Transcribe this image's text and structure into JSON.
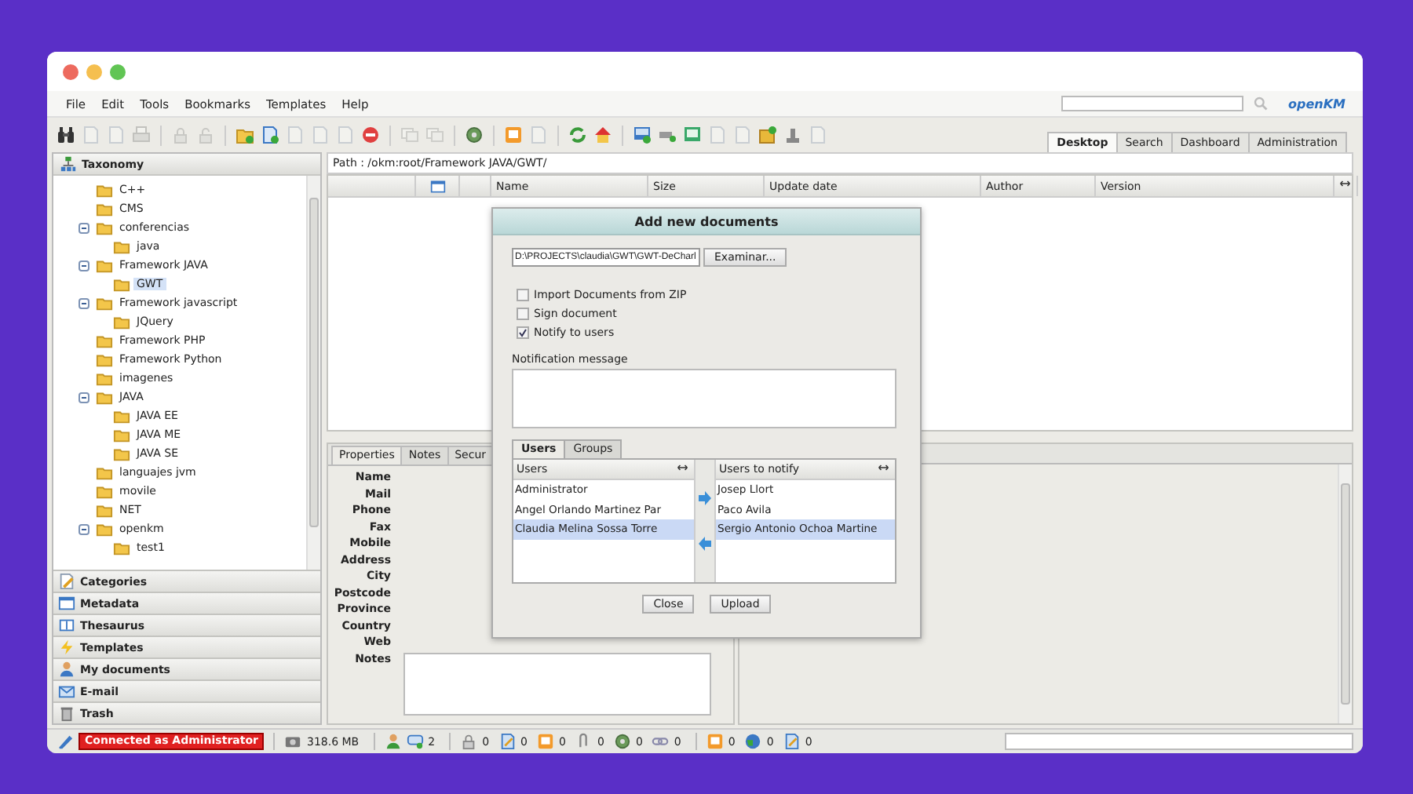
{
  "menu": [
    "File",
    "Edit",
    "Tools",
    "Bookmarks",
    "Templates",
    "Help"
  ],
  "logo": "openKM",
  "toolbar": [
    {
      "kind": "binoculars",
      "disabled": false
    },
    {
      "kind": "document",
      "disabled": true
    },
    {
      "kind": "document",
      "disabled": true
    },
    {
      "kind": "printer",
      "disabled": true
    },
    {
      "kind": "separator"
    },
    {
      "kind": "padlock",
      "disabled": true
    },
    {
      "kind": "padlock-open",
      "disabled": true
    },
    {
      "kind": "separator"
    },
    {
      "kind": "folder-plus",
      "disabled": false
    },
    {
      "kind": "document-plus",
      "disabled": false
    },
    {
      "kind": "document",
      "disabled": true
    },
    {
      "kind": "document",
      "disabled": true
    },
    {
      "kind": "document",
      "disabled": true
    },
    {
      "kind": "delete",
      "disabled": false
    },
    {
      "kind": "separator"
    },
    {
      "kind": "copy",
      "disabled": true
    },
    {
      "kind": "copy",
      "disabled": true
    },
    {
      "kind": "separator"
    },
    {
      "kind": "gear",
      "disabled": false
    },
    {
      "kind": "separator"
    },
    {
      "kind": "note",
      "disabled": false
    },
    {
      "kind": "document",
      "disabled": true
    },
    {
      "kind": "separator"
    },
    {
      "kind": "refresh",
      "disabled": false
    },
    {
      "kind": "home",
      "disabled": false
    },
    {
      "kind": "separator"
    },
    {
      "kind": "monitor-plus",
      "disabled": false
    },
    {
      "kind": "pipe",
      "disabled": false
    },
    {
      "kind": "monitor",
      "disabled": false
    },
    {
      "kind": "document",
      "disabled": true
    },
    {
      "kind": "document",
      "disabled": true
    },
    {
      "kind": "package",
      "disabled": false
    },
    {
      "kind": "stamp",
      "disabled": false
    },
    {
      "kind": "document",
      "disabled": true
    }
  ],
  "main_tabs": [
    {
      "label": "Desktop",
      "selected": true
    },
    {
      "label": "Search",
      "selected": false
    },
    {
      "label": "Dashboard",
      "selected": false
    },
    {
      "label": "Administration",
      "selected": false
    }
  ],
  "taxonomy": {
    "title": "Taxonomy",
    "tree": [
      {
        "label": "C++",
        "selected": false
      },
      {
        "label": "CMS",
        "selected": false
      },
      {
        "label": "conferencias",
        "selected": false,
        "expanded": true,
        "children": [
          {
            "label": "java",
            "selected": false
          }
        ]
      },
      {
        "label": "Framework JAVA",
        "selected": false,
        "expanded": true,
        "children": [
          {
            "label": "GWT",
            "selected": true
          }
        ]
      },
      {
        "label": "Framework javascript",
        "selected": false,
        "expanded": true,
        "children": [
          {
            "label": "JQuery",
            "selected": false
          }
        ]
      },
      {
        "label": "Framework PHP",
        "selected": false
      },
      {
        "label": "Framework Python",
        "selected": false
      },
      {
        "label": "imagenes",
        "selected": false
      },
      {
        "label": "JAVA",
        "selected": false,
        "expanded": true,
        "children": [
          {
            "label": "JAVA EE",
            "selected": false
          },
          {
            "label": "JAVA ME",
            "selected": false
          },
          {
            "label": "JAVA SE",
            "selected": false
          }
        ]
      },
      {
        "label": "languajes jvm",
        "selected": false
      },
      {
        "label": "movile",
        "selected": false
      },
      {
        "label": "NET",
        "selected": false
      },
      {
        "label": "openkm",
        "selected": false,
        "expanded": true,
        "children": [
          {
            "label": "test1",
            "selected": false
          }
        ]
      }
    ]
  },
  "panels": [
    {
      "label": "Categories",
      "kind": "pencil"
    },
    {
      "label": "Metadata",
      "kind": "table"
    },
    {
      "label": "Thesaurus",
      "kind": "book"
    },
    {
      "label": "Templates",
      "kind": "bolt"
    },
    {
      "label": "My documents",
      "kind": "person"
    },
    {
      "label": "E-mail",
      "kind": "envelope"
    },
    {
      "label": "Trash",
      "kind": "trash"
    }
  ],
  "path": "Path : /okm:root/Framework JAVA/GWT/",
  "columns": [
    "Name",
    "Size",
    "Update date",
    "Author",
    "Version"
  ],
  "properties_tabs": [
    {
      "label": "Properties",
      "selected": true
    },
    {
      "label": "Notes",
      "selected": false
    },
    {
      "label": "Secur",
      "selected": false
    }
  ],
  "properties": [
    "Name",
    "Mail",
    "Phone",
    "Fax",
    "Mobile",
    "Address",
    "City",
    "Postcode",
    "Province",
    "Country",
    "Web",
    "Notes"
  ],
  "dialog": {
    "title": "Add new documents",
    "file_path": "D:\\PROJECTS\\claudia\\GWT\\GWT-DeCharl",
    "browse_button": "Examinar...",
    "options": [
      {
        "label": "Import Documents from ZIP",
        "checked": false
      },
      {
        "label": "Sign document",
        "checked": false
      },
      {
        "label": "Notify to users",
        "checked": true
      }
    ],
    "message_label": "Notification message",
    "tabs": [
      {
        "label": "Users",
        "selected": true
      },
      {
        "label": "Groups",
        "selected": false
      }
    ],
    "users": {
      "header": "Users",
      "items": [
        {
          "name": "Administrator",
          "selected": false
        },
        {
          "name": "Angel Orlando Martinez Par",
          "selected": false
        },
        {
          "name": "Claudia Melina Sossa Torre",
          "selected": true
        }
      ]
    },
    "notify": {
      "header": "Users to notify",
      "items": [
        {
          "name": "Josep Llort",
          "selected": false
        },
        {
          "name": "Paco Avila",
          "selected": false
        },
        {
          "name": "Sergio Antonio Ochoa Martine",
          "selected": true
        }
      ]
    },
    "buttons": [
      "Close",
      "Upload"
    ]
  },
  "status_bar": {
    "connection": "Connected as Administrator",
    "memory": "318.6 MB",
    "groups": [
      [
        {
          "kind": "user"
        },
        {
          "kind": "chat",
          "count": "2"
        }
      ],
      [
        {
          "kind": "padlock",
          "count": "0"
        },
        {
          "kind": "edit",
          "count": "0"
        },
        {
          "kind": "note",
          "count": "0"
        },
        {
          "kind": "clip",
          "count": "0"
        },
        {
          "kind": "gear",
          "count": "0"
        },
        {
          "kind": "link",
          "count": "0"
        }
      ],
      [
        {
          "kind": "note",
          "count": "0"
        },
        {
          "kind": "globe",
          "count": "0"
        },
        {
          "kind": "edit",
          "count": "0"
        }
      ]
    ]
  }
}
